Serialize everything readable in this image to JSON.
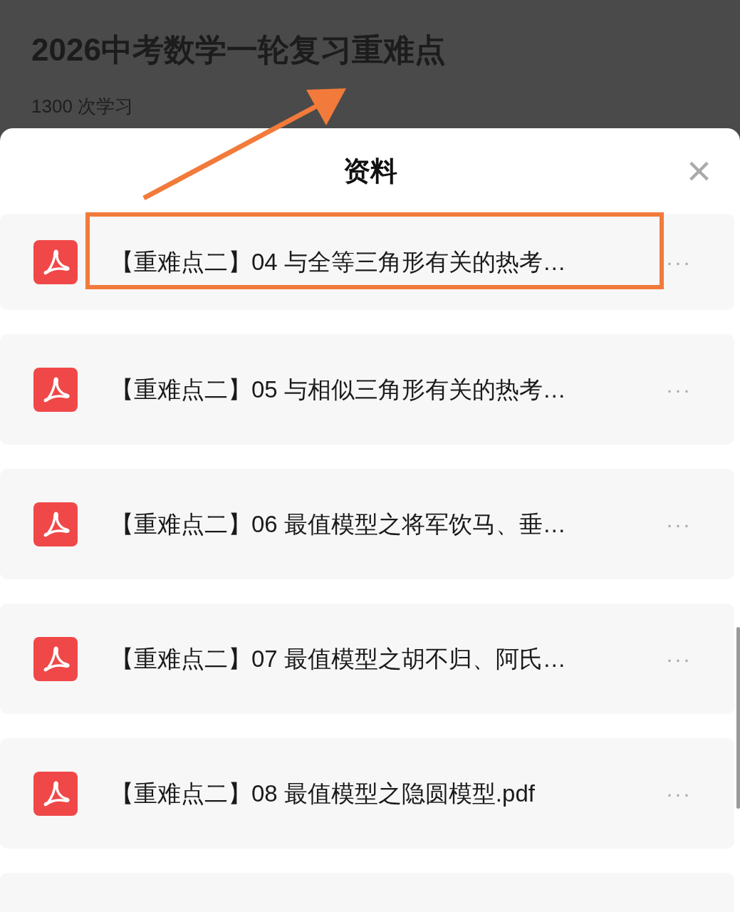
{
  "course": {
    "title": "2026中考数学一轮复习重难点",
    "stats": "1300 次学习"
  },
  "sheet": {
    "title": "资料",
    "close": "×"
  },
  "files": [
    {
      "name": "【重难点二】04 与全等三角形有关的热考…",
      "more": "···",
      "highlighted": true
    },
    {
      "name": "【重难点二】05 与相似三角形有关的热考…",
      "more": "···",
      "highlighted": false
    },
    {
      "name": "【重难点二】06 最值模型之将军饮马、垂…",
      "more": "···",
      "highlighted": false
    },
    {
      "name": "【重难点二】07 最值模型之胡不归、阿氏…",
      "more": "···",
      "highlighted": false
    },
    {
      "name": "【重难点二】08 最值模型之隐圆模型.pdf",
      "more": "···",
      "highlighted": false
    }
  ]
}
